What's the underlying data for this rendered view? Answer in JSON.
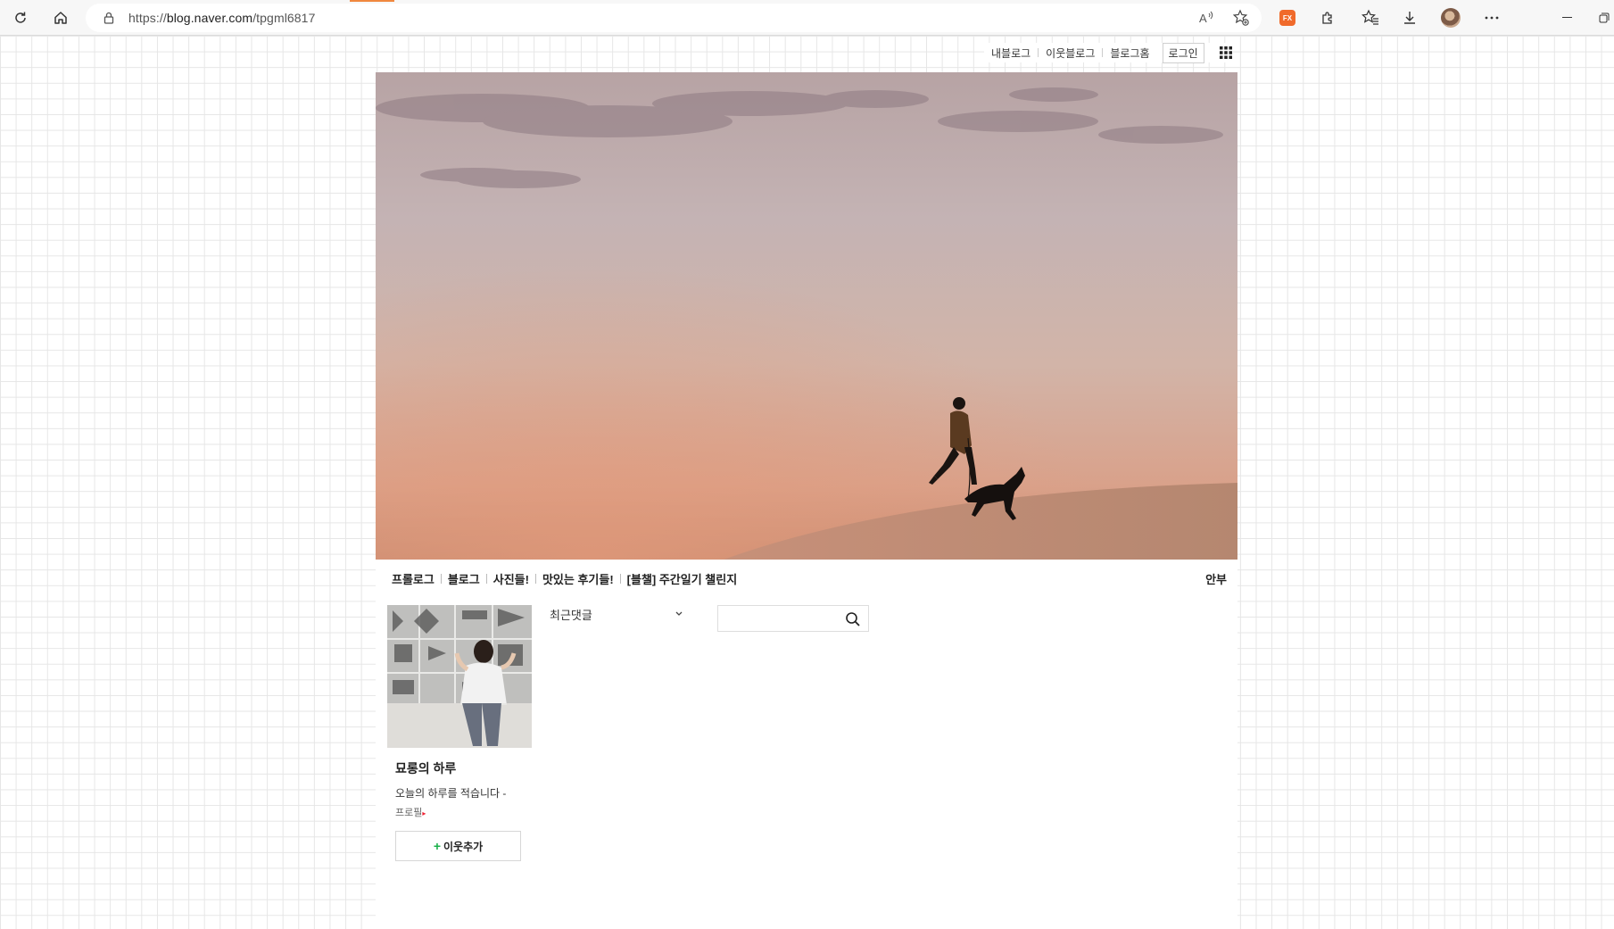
{
  "browser": {
    "url_prefix": "https://",
    "url_domain": "blog.naver.com",
    "url_path": "/tpgml6817",
    "reader_label": "A",
    "ext_label": "FX",
    "icons": [
      "refresh-icon",
      "home-icon",
      "lock-icon",
      "read-aloud-icon",
      "favorite-add-icon",
      "extension-icon",
      "puzzle-icon",
      "favorites-icon",
      "download-icon",
      "profile-avatar",
      "more-icon",
      "minimize-icon",
      "restore-icon"
    ]
  },
  "top_util": {
    "my_blog": "내블로그",
    "neighbor_blog": "이웃블로그",
    "blog_home": "블로그홈",
    "login": "로그인"
  },
  "menu": {
    "items": [
      "프롤로그",
      "블로그",
      "사진들!",
      "맛있는 후기들!",
      "[블챌] 주간일기 챌린지"
    ],
    "right": "안부"
  },
  "profile": {
    "name": "묘롱의 하루",
    "intro": "오늘의 하루를 적습니다 -",
    "link": "프로필",
    "neighbor_add": "이웃추가"
  },
  "widgets": {
    "recent_comments": "최근댓글",
    "search_placeholder": ""
  },
  "colors": {
    "menu_sep": "#bbbbbb",
    "neighbor_plus": "#1ab04a",
    "profile_arrow": "#ee2233"
  }
}
